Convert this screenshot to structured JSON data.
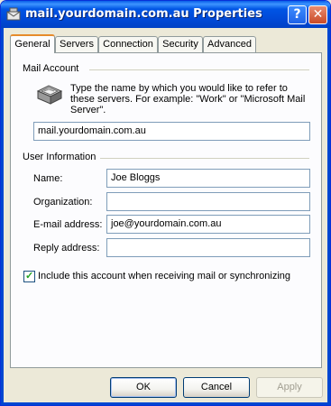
{
  "window": {
    "title": "mail.yourdomain.com.au Properties",
    "help_label": "?",
    "close_label": "✕"
  },
  "tabs": [
    {
      "label": "General",
      "active": true
    },
    {
      "label": "Servers"
    },
    {
      "label": "Connection"
    },
    {
      "label": "Security"
    },
    {
      "label": "Advanced"
    }
  ],
  "mail_account": {
    "group_label": "Mail Account",
    "description": "Type the name by which you would like to refer to these servers.  For example: \"Work\" or \"Microsoft Mail Server\".",
    "account_name": "mail.yourdomain.com.au",
    "icon": "mail-server-icon"
  },
  "user_info": {
    "group_label": "User Information",
    "name_label": "Name:",
    "name_value": "Joe Bloggs",
    "organization_label": "Organization:",
    "organization_value": "",
    "email_label": "E-mail address:",
    "email_value": "joe@yourdomain.com.au",
    "reply_label": "Reply address:",
    "reply_value": ""
  },
  "include_checkbox": {
    "label": "Include this account when receiving mail or synchronizing",
    "checked": true
  },
  "buttons": {
    "ok": "OK",
    "cancel": "Cancel",
    "apply": "Apply"
  }
}
